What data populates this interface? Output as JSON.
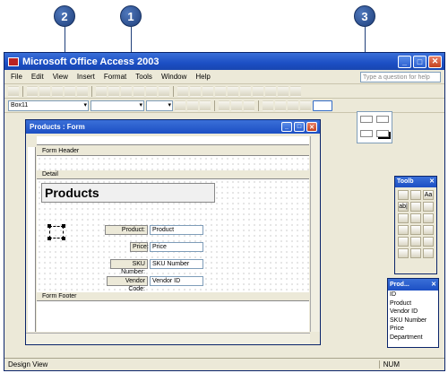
{
  "callouts": [
    "2",
    "1",
    "3"
  ],
  "app": {
    "title": "Microsoft Office Access 2003",
    "menu": [
      "File",
      "Edit",
      "View",
      "Insert",
      "Format",
      "Tools",
      "Window",
      "Help"
    ],
    "help_placeholder": "Type a question for help",
    "object_combo": "Box11",
    "status_left": "Design View",
    "status_right": "NUM"
  },
  "form": {
    "title": "Products : Form",
    "sections": [
      "Form Header",
      "Detail",
      "Form Footer"
    ],
    "heading": "Products",
    "controls": [
      {
        "label": "Product:",
        "field": "Product"
      },
      {
        "label": "Price:",
        "field": "Price"
      },
      {
        "label": "SKU Number:",
        "field": "SKU Number"
      },
      {
        "label": "Vendor Code:",
        "field": "Vendor ID"
      }
    ]
  },
  "toolbox": {
    "title": "Toolb",
    "tools": [
      "",
      "",
      "Aa",
      "ab|",
      "",
      "",
      "",
      "",
      "",
      "",
      "",
      "",
      "",
      "",
      "",
      "",
      "",
      ""
    ]
  },
  "field_list": {
    "title": "Prod...",
    "fields": [
      "ID",
      "Product",
      "Vendor ID",
      "SKU Number",
      "Price",
      "Department"
    ]
  }
}
